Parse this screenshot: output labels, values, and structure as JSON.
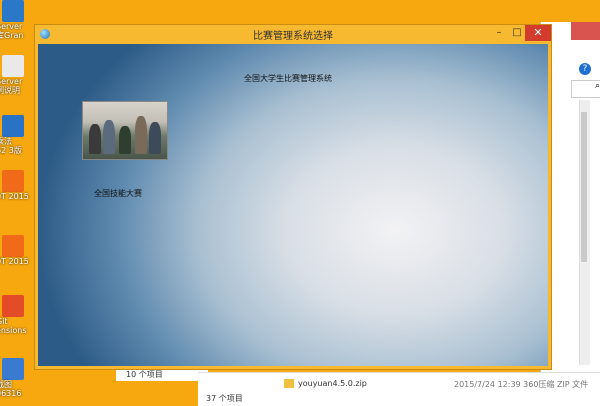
{
  "desktop": {
    "icons": [
      {
        "label": "Server",
        "label2": "库Gran",
        "color": "#2b77c8"
      },
      {
        "label": "Server",
        "label2": "例说明",
        "color": "#e9e9e9"
      },
      {
        "label": "乘法",
        "label2": "62 3版",
        "color": "#2a72c6"
      },
      {
        "label": "0T 2015",
        "label2": "",
        "color": "#f06a1a"
      },
      {
        "label": "0T 2015",
        "label2": "",
        "color": "#f06a1a"
      },
      {
        "label": "Git",
        "label2": "ensions",
        "color": "#e34c26"
      },
      {
        "label": "截图",
        "label2": "06316",
        "color": "#3a7ad0"
      }
    ]
  },
  "explorer": {
    "help_glyph": "?",
    "search_glyph": "⌕",
    "file_name": "youyuan4.5.0.zip",
    "file_meta": "2015/7/24 12:39    360压缩 ZIP 文件",
    "items_count": "37 个项目",
    "items_top": "10 个项目"
  },
  "window": {
    "title": "比赛管理系统选择",
    "min_glyph": "–",
    "max_glyph": "□",
    "close_glyph": "✕",
    "system_label": "全国大学生比赛管理系统",
    "competition_label": "全国技能大赛"
  }
}
